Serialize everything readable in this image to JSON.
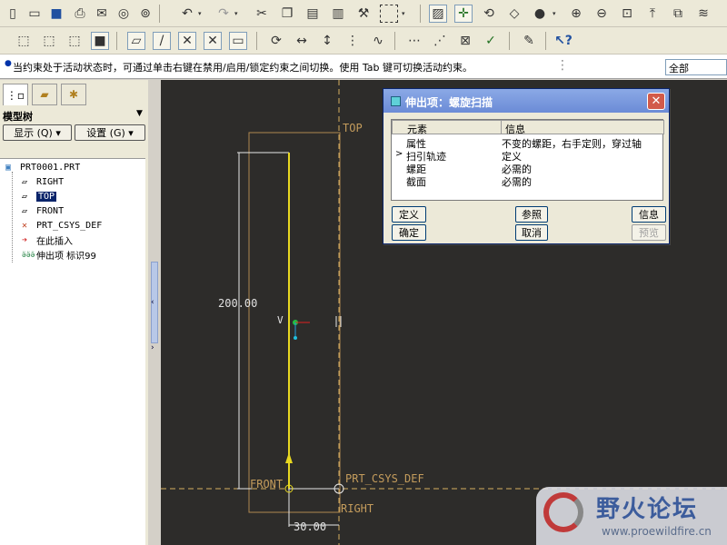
{
  "toolbar1": {
    "icons": [
      "new-icon",
      "open-icon",
      "save-icon",
      "print-icon",
      "send-icon",
      "erase-icon",
      "undo-icon",
      "redo-icon",
      "cut-icon",
      "copy-icon",
      "paste-icon",
      "paste-special-icon",
      "regenerate-icon",
      "select-box-icon",
      "repaint-icon",
      "spin-center-icon",
      "orient-icon",
      "saved-view-icon",
      "shade-icon",
      "zoom-in-icon",
      "zoom-out-icon",
      "refit-icon",
      "view-manager-icon",
      "layers-icon"
    ]
  },
  "toolbar2": {
    "icons": [
      "wireframe-icon",
      "hidden-line-icon",
      "no-hidden-icon",
      "shading-icon",
      "datum-plane-icon",
      "datum-axis-icon",
      "datum-point-icon",
      "coord-sys-icon",
      "annotation-icon",
      "rotate-icon",
      "dimension-icon",
      "annotation-element-icon",
      "datum-display-icon",
      "curve-icon",
      "grid-icon",
      "relation-icon",
      "checkbox-icon",
      "sketch-tool-icon",
      "whats-this-icon"
    ]
  },
  "message": {
    "text": "当约束处于活动状态时，可通过单击右键在禁用/启用/锁定约束之间切换。使用 Tab 键可切换活动约束。"
  },
  "filter": {
    "value": "全部"
  },
  "model_tree": {
    "label": "模型树",
    "show_button": "显示 (Q) ▾",
    "settings_button": "设置 (G) ▾",
    "items": [
      {
        "label": "PRT0001.PRT",
        "icon": "part-icon"
      },
      {
        "label": "RIGHT",
        "icon": "datum-plane-icon"
      },
      {
        "label": "TOP",
        "icon": "datum-plane-icon",
        "selected": true
      },
      {
        "label": "FRONT",
        "icon": "datum-plane-icon"
      },
      {
        "label": "PRT_CSYS_DEF",
        "icon": "coord-sys-icon"
      },
      {
        "label": "在此插入",
        "icon": "insert-here-icon"
      },
      {
        "label": "伸出项 标识99",
        "icon": "protrusion-icon"
      }
    ]
  },
  "viewport": {
    "labels": {
      "top": "TOP",
      "front": "FRONT",
      "right": "RIGHT",
      "csys": "PRT_CSYS_DEF",
      "dim_height": "200.00",
      "dim_width": "30.00",
      "v_marker": "V"
    }
  },
  "dialog": {
    "title": "伸出项：螺旋扫描",
    "headers": {
      "element": "元素",
      "info": "信息"
    },
    "rows": [
      {
        "element": "属性",
        "info": "不变的螺距，右手定则，穿过轴"
      },
      {
        "element": "扫引轨迹",
        "info": "定义",
        "active": true
      },
      {
        "element": "螺距",
        "info": "必需的"
      },
      {
        "element": "截面",
        "info": "必需的"
      }
    ],
    "buttons": {
      "define": "定义",
      "reference": "参照",
      "info": "信息",
      "ok": "确定",
      "cancel": "取消",
      "preview": "预览"
    }
  },
  "watermark": {
    "title": "野火论坛",
    "url": "www.proewildfire.cn"
  }
}
